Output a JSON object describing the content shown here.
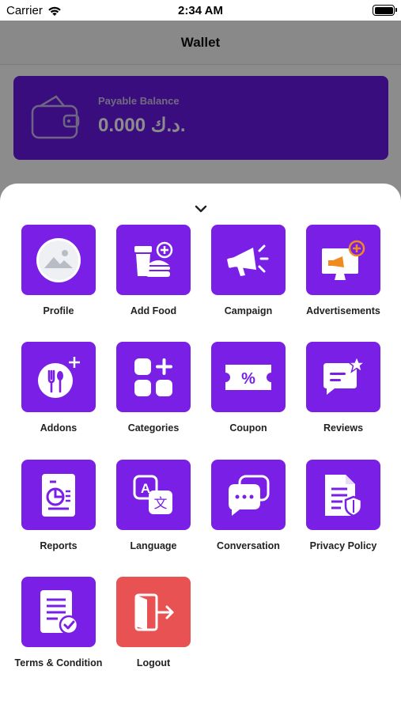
{
  "status_bar": {
    "carrier": "Carrier",
    "time": "2:34 AM"
  },
  "app": {
    "title": "Wallet",
    "balance_label": "Payable Balance",
    "balance_value": "0.000 د.ك."
  },
  "colors": {
    "accent": "#7a1fe6",
    "logout": "#e85252",
    "card": "#6a19e6"
  },
  "menu": {
    "items": [
      {
        "label": "Profile",
        "icon": "profile-image-icon"
      },
      {
        "label": "Add Food",
        "icon": "add-food-icon"
      },
      {
        "label": "Campaign",
        "icon": "megaphone-icon"
      },
      {
        "label": "Advertisements",
        "icon": "advertisement-icon"
      },
      {
        "label": "Addons",
        "icon": "addons-icon"
      },
      {
        "label": "Categories",
        "icon": "categories-icon"
      },
      {
        "label": "Coupon",
        "icon": "coupon-icon"
      },
      {
        "label": "Reviews",
        "icon": "reviews-icon"
      },
      {
        "label": "Reports",
        "icon": "reports-icon"
      },
      {
        "label": "Language",
        "icon": "language-icon"
      },
      {
        "label": "Conversation",
        "icon": "conversation-icon"
      },
      {
        "label": "Privacy Policy",
        "icon": "privacy-policy-icon"
      },
      {
        "label": "Terms & Condition",
        "icon": "terms-icon"
      },
      {
        "label": "Logout",
        "icon": "logout-icon"
      }
    ]
  }
}
